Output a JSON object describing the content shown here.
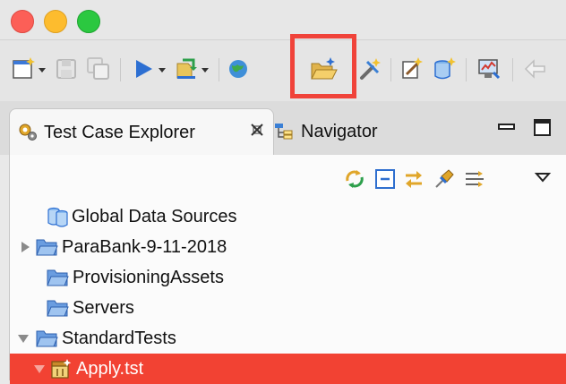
{
  "window": {
    "controls": [
      "close",
      "minimize",
      "zoom"
    ]
  },
  "toolbar": {
    "buttons": [
      {
        "icon": "new-icon",
        "has_dropdown": true
      },
      {
        "icon": "save-icon",
        "enabled": false
      },
      {
        "icon": "save-all-icon",
        "enabled": false
      },
      {
        "icon": "run-icon",
        "has_dropdown": true
      },
      {
        "icon": "deploy-icon",
        "has_dropdown": true
      },
      {
        "icon": "globe-icon"
      },
      {
        "icon": "open-folder-icon",
        "highlighted": true
      },
      {
        "icon": "tools-icon"
      },
      {
        "icon": "wizard-icon"
      },
      {
        "icon": "new-data-source-icon"
      },
      {
        "icon": "monitor-icon"
      },
      {
        "icon": "back-icon",
        "enabled": false
      }
    ],
    "highlight_color": "#f0433a"
  },
  "tabs": [
    {
      "label": "Test Case Explorer",
      "icon": "gear-icon",
      "active": true,
      "closable": true
    },
    {
      "label": "Navigator",
      "icon": "navigator-icon",
      "active": false
    }
  ],
  "view_toolbar": {
    "buttons": [
      "refresh-icon",
      "collapse-all-icon",
      "link-with-editor-icon",
      "pin-icon",
      "filter-icon",
      "view-menu-icon"
    ]
  },
  "tree": {
    "items": [
      {
        "label": "Global Data Sources",
        "icon": "data-source-icon",
        "expander": "none",
        "selected": false
      },
      {
        "label": "ParaBank-9-11-2018",
        "icon": "folder-icon",
        "expander": "collapsed",
        "selected": false
      },
      {
        "label": "ProvisioningAssets",
        "icon": "folder-icon",
        "expander": "none",
        "selected": false
      },
      {
        "label": "Servers",
        "icon": "folder-icon",
        "expander": "none",
        "selected": false
      },
      {
        "label": "StandardTests",
        "icon": "folder-icon",
        "expander": "expanded",
        "selected": false
      },
      {
        "label": "Apply.tst",
        "icon": "test-suite-icon",
        "expander": "expanded",
        "selected": true
      }
    ]
  },
  "colors": {
    "selection": "#f24233",
    "folder": "#4f86d6",
    "accent": "#2f6fcf"
  }
}
